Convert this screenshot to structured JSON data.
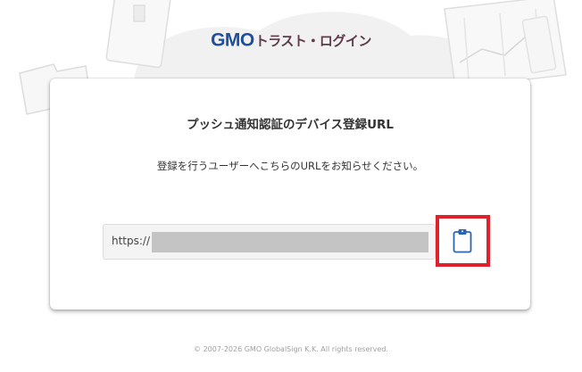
{
  "header": {
    "logo_gmo": "GMO",
    "logo_product": "トラスト・ログイン"
  },
  "card": {
    "title": "プッシュ通知認証のデバイス登録URL",
    "description": "登録を行うユーザーへこちらのURLをお知らせください。",
    "url_prefix": "https://",
    "copy_icon": "clipboard-icon"
  },
  "footer": {
    "copyright": "© 2007-2026 GMO GlobalSign K.K. All rights reserved."
  },
  "colors": {
    "brand_blue": "#1f4f9d",
    "brand_maroon": "#5e3a4b",
    "highlight_red": "#e0202a",
    "icon_blue": "#2c64b0"
  }
}
